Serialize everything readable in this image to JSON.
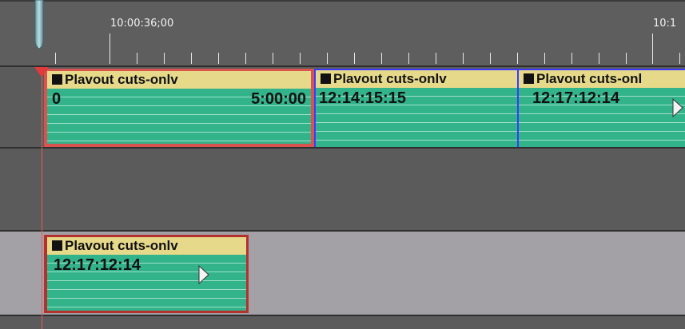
{
  "ruler": {
    "timecodes": [
      "10:00:36;00",
      "10:1"
    ]
  },
  "tracks": {
    "video1": {
      "clips": [
        {
          "title": "Plavout cuts-onlv",
          "tc_in": "0",
          "tc_out": "5:00:00",
          "selected": true
        },
        {
          "title": "Plavout cuts-onlv",
          "tc_in": "12:14:15:15"
        },
        {
          "title": "Plavout cuts-onl",
          "tc_in": "12:17:12:14",
          "has_play_arrow": true
        }
      ]
    },
    "audio1": {
      "clips": [
        {
          "title": "Plavout cuts-onlv",
          "tc_in": "12:17:12:14",
          "has_play_arrow": true
        }
      ]
    }
  },
  "colors": {
    "clip_body": "#32b38a",
    "clip_header": "#e7d98a",
    "selected_border": "#d9534f",
    "clip_boundary": "#3a3aff",
    "playhead": "#e65c5c",
    "track_dark": "#5b5b5b",
    "track_light": "#a3a1a6"
  },
  "icons": {
    "playhead_handle": "playhead-handle-icon",
    "clip_marker": "square-icon",
    "play_arrow": "play-arrow-icon"
  }
}
